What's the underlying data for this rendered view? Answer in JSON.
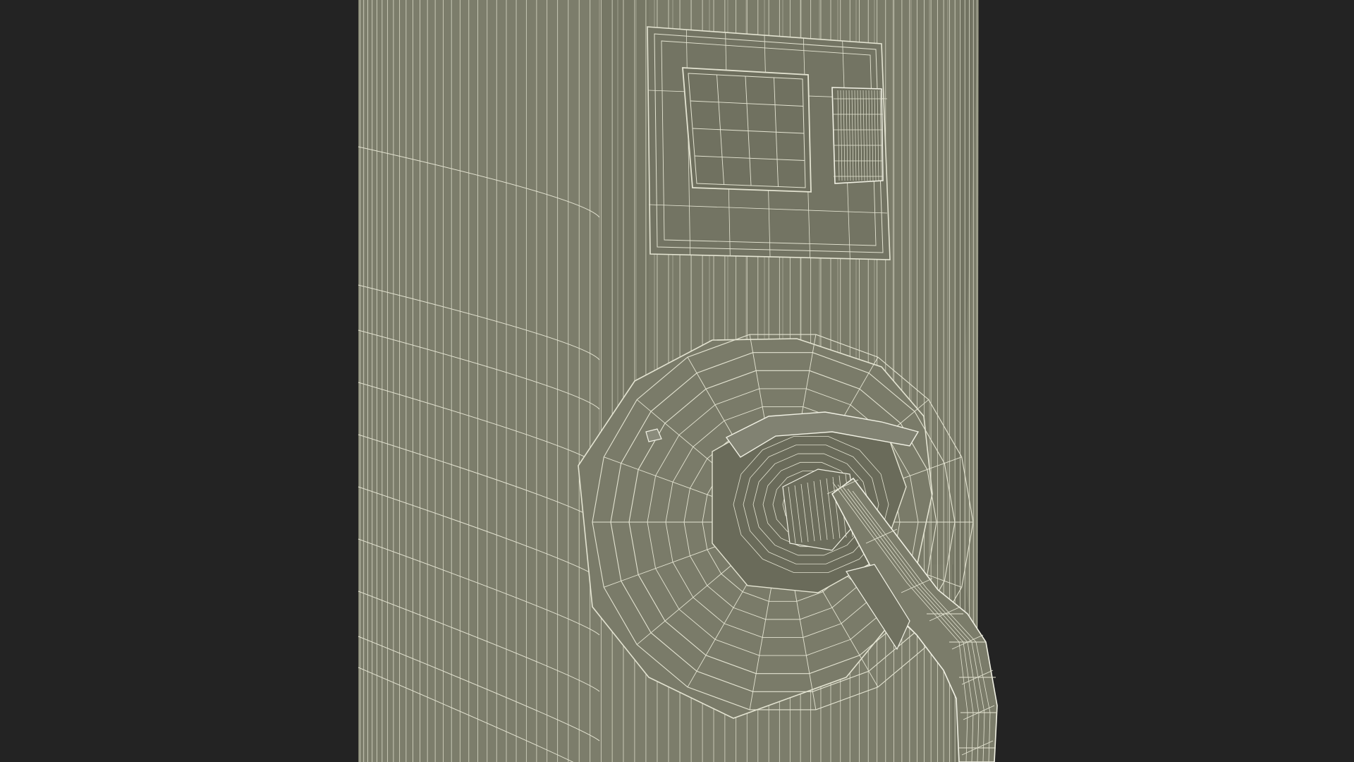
{
  "scene": {
    "subject": "wireframe-ev-charging-station",
    "colors": {
      "background": "#232323",
      "surface": "#7c7d6b",
      "surface_shadow": "#656656",
      "surface_highlight": "#86877a",
      "panel": "#737463",
      "wire": "#e4e4d2",
      "wire_dense": "#f1f1e4"
    }
  }
}
